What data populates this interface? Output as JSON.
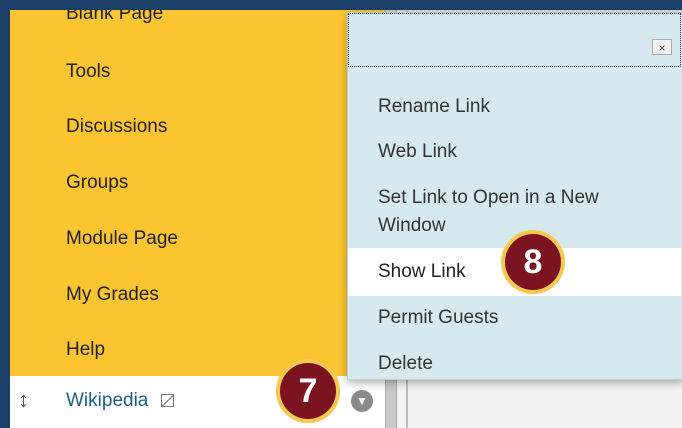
{
  "sidebar": {
    "items": [
      {
        "label": "Blank Page"
      },
      {
        "label": "Tools"
      },
      {
        "label": "Discussions"
      },
      {
        "label": "Groups"
      },
      {
        "label": "Module Page"
      },
      {
        "label": "My Grades"
      },
      {
        "label": "Help"
      }
    ],
    "selected_item": {
      "label": "Wikipedia"
    }
  },
  "context_menu": {
    "items": [
      {
        "label": "Rename Link"
      },
      {
        "label": "Web Link"
      },
      {
        "label": "Set Link to Open in a New Window"
      },
      {
        "label": "Show Link"
      },
      {
        "label": "Permit Guests"
      },
      {
        "label": "Delete"
      }
    ],
    "close_label": "×"
  },
  "steps": {
    "first": "7",
    "second": "8"
  },
  "icons": {
    "drag": "drag-handle-icon",
    "unavailable": "link-unavailable-icon",
    "chevron": "chevron-down-icon",
    "close": "close-icon"
  },
  "colors": {
    "sidebar_bg": "#fbc531",
    "menu_bg": "#d5e9ee",
    "badge_bg": "#7b1420",
    "link_text": "#1b5f86",
    "frame": "#1b3f66"
  }
}
